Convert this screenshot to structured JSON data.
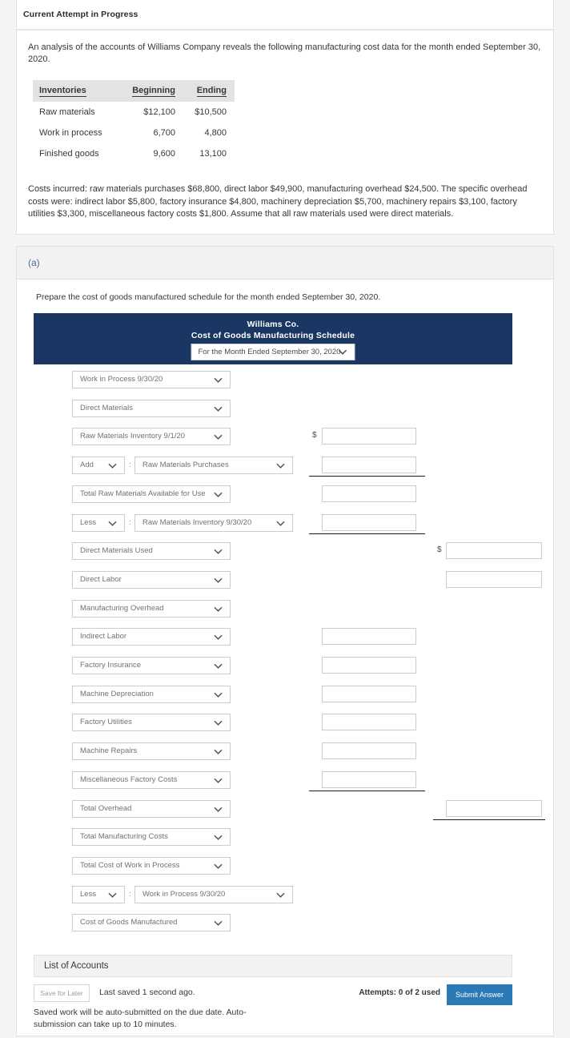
{
  "attempt": {
    "title": "Current Attempt in Progress"
  },
  "problem": {
    "intro": "An analysis of the accounts of Williams Company reveals the following manufacturing cost data for the month ended September 30, 2020.",
    "inventory_table": {
      "headers": [
        "Inventories",
        "Beginning",
        "Ending"
      ],
      "rows": [
        {
          "label": "Raw materials",
          "beginning": "$12,100",
          "ending": "$10,500"
        },
        {
          "label": "Work in process",
          "beginning": "6,700",
          "ending": "4,800"
        },
        {
          "label": "Finished goods",
          "beginning": "9,600",
          "ending": "13,100"
        }
      ]
    },
    "costs_paragraph": "Costs incurred: raw materials purchases $68,800, direct labor $49,900, manufacturing overhead $24,500. The specific overhead costs were: indirect labor $5,800, factory insurance $4,800, machinery depreciation $5,700, machinery repairs $3,100, factory utilities $3,300, miscellaneous factory costs $1,800. Assume that all raw materials used were direct materials."
  },
  "part_a": {
    "label": "(a)",
    "instruction": "Prepare the cost of goods manufactured schedule for the month ended September 30, 2020."
  },
  "schedule": {
    "company": "Williams Co.",
    "title": "Cost of Goods Manufacturing Schedule",
    "period_select": "For the Month Ended September 30, 2020",
    "rows": [
      {
        "type": "single",
        "label": "Work in Process 9/30/20"
      },
      {
        "type": "single",
        "label": "Direct Materials"
      },
      {
        "type": "single",
        "label": "Raw Materials Inventory 9/1/20",
        "input": "c1",
        "dollar": "$"
      },
      {
        "type": "pair",
        "prefix": "Add",
        "label": "Raw Materials Purchases",
        "input": "c1"
      },
      {
        "type": "single",
        "label": "Total Raw Materials Available for Use",
        "input": "c1"
      },
      {
        "type": "pair",
        "prefix": "Less",
        "label": "Raw Materials Inventory 9/30/20",
        "input": "c1"
      },
      {
        "type": "single",
        "label": "Direct Materials Used",
        "input": "c2",
        "dollar": "$"
      },
      {
        "type": "single",
        "label": "Direct Labor",
        "input": "c2"
      },
      {
        "type": "single",
        "label": "Manufacturing Overhead"
      },
      {
        "type": "single",
        "label": "Indirect Labor",
        "input": "c1"
      },
      {
        "type": "single",
        "label": "Factory Insurance",
        "input": "c1"
      },
      {
        "type": "single",
        "label": "Machine Depreciation",
        "input": "c1"
      },
      {
        "type": "single",
        "label": "Factory Utilities",
        "input": "c1"
      },
      {
        "type": "single",
        "label": "Machine Repairs",
        "input": "c1"
      },
      {
        "type": "single",
        "label": "Miscellaneous Factory Costs",
        "input": "c1"
      },
      {
        "type": "single",
        "label": "Total Overhead",
        "input": "c2"
      },
      {
        "type": "single",
        "label": "Total Manufacturing Costs"
      },
      {
        "type": "single",
        "label": "Total Cost of Work in Process"
      },
      {
        "type": "pair",
        "prefix": "Less",
        "label": "Work in Process 9/30/20"
      },
      {
        "type": "single",
        "label": "Cost of Goods Manufactured"
      }
    ],
    "prefix_colon": ":"
  },
  "footer": {
    "accounts_label": "List of Accounts",
    "save_for_later": "Save for Later",
    "last_saved": "Last saved 1 second ago.",
    "attempts": "Attempts: 0 of 2 used",
    "submit": "Submit Answer",
    "auto_note": "Saved work will be auto-submitted on the due date. Auto-submission can take up to 10 minutes."
  },
  "colors": {
    "navy": "#1a3764",
    "submit_blue": "#2b7ab5",
    "band_gray": "#f2f2f2",
    "accent_link": "#4c6e93"
  }
}
